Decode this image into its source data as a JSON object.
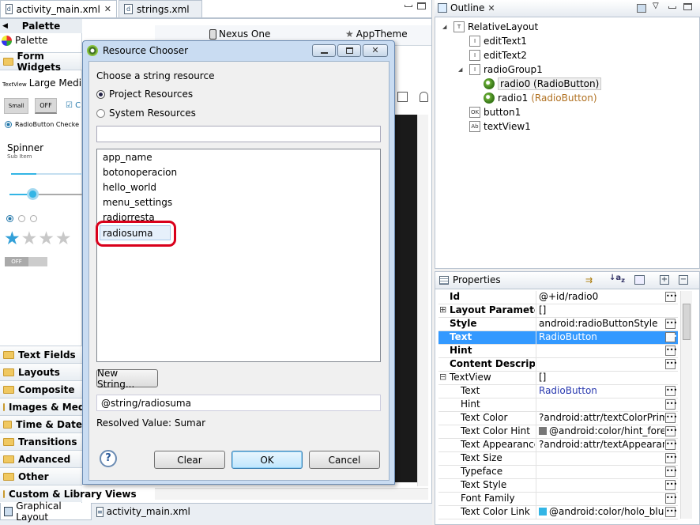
{
  "editor_tabs": [
    {
      "label": "activity_main.xml",
      "close": "✕"
    },
    {
      "label": "strings.xml"
    }
  ],
  "palette": {
    "header": "Palette",
    "title": "Palette",
    "section": "Form Widgets",
    "textview_label": "TextView",
    "text_sizes": "Large Mediu",
    "small_btn": "Small",
    "off_toggle": "OFF",
    "radio_checked": "RadioButton Checke",
    "spinner_title": "Spinner",
    "spinner_sub": "Sub Item",
    "switch_label": "OFF",
    "categories": [
      "Text Fields",
      "Layouts",
      "Composite",
      "Images & Med",
      "Time & Date",
      "Transitions",
      "Advanced",
      "Other",
      "Custom & Library Views"
    ]
  },
  "toolbar": {
    "device": "Nexus One",
    "theme": "AppTheme"
  },
  "bottom_tabs": {
    "graphical": "Graphical Layout",
    "xml": "activity_main.xml"
  },
  "outline": {
    "title": "Outline",
    "close": "✕",
    "items": [
      {
        "label": "RelativeLayout",
        "icon": "T"
      },
      {
        "label": "editText1",
        "icon": "I"
      },
      {
        "label": "editText2",
        "icon": "I"
      },
      {
        "label": "radioGroup1",
        "icon": "I"
      },
      {
        "label": "radio0 (RadioButton)",
        "icon": "radio"
      },
      {
        "label": "radio1",
        "suffix": "(RadioButton)",
        "icon": "radio"
      },
      {
        "label": "button1",
        "icon": "OK"
      },
      {
        "label": "textView1",
        "icon": "Ab"
      }
    ]
  },
  "properties": {
    "title": "Properties",
    "rows": [
      {
        "k": "Id",
        "v": "@+id/radio0",
        "style": "bold",
        "dots": true
      },
      {
        "k": "Layout Parameters",
        "v": "[]",
        "style": "bold",
        "expander": "⊞"
      },
      {
        "k": "Style",
        "v": "android:radioButtonStyle",
        "style": "bold",
        "dots": true
      },
      {
        "k": "Text",
        "v": "RadioButton",
        "style": "bold sel",
        "dots": true
      },
      {
        "k": "Hint",
        "v": "",
        "style": "bold",
        "dots": true
      },
      {
        "k": "Content Descript...",
        "v": "",
        "style": "bold",
        "dots": true
      },
      {
        "k": "TextView",
        "v": "[]",
        "style": "",
        "expander": "⊟"
      },
      {
        "k": "Text",
        "v": "RadioButton",
        "style": "indent",
        "dots": true,
        "blue": true
      },
      {
        "k": "Hint",
        "v": "",
        "style": "indent",
        "dots": true
      },
      {
        "k": "Text Color",
        "v": "?android:attr/textColorPrima...",
        "style": "indent",
        "dots": true
      },
      {
        "k": "Text Color Hint",
        "v": "@android:color/hint_fore...",
        "style": "indent",
        "dots": true,
        "swatch": "#777777"
      },
      {
        "k": "Text Appearance",
        "v": "?android:attr/textAppearance ...",
        "style": "indent",
        "dots": true
      },
      {
        "k": "Text Size",
        "v": "",
        "style": "indent",
        "dots": true
      },
      {
        "k": "Typeface",
        "v": "",
        "style": "indent",
        "dots": true
      },
      {
        "k": "Text Style",
        "v": "",
        "style": "indent",
        "dots": true
      },
      {
        "k": "Font Family",
        "v": "",
        "style": "indent",
        "dots": true
      },
      {
        "k": "Text Color Link",
        "v": "@android:color/holo_blue...",
        "style": "indent",
        "dots": true,
        "swatch": "#33b5e5"
      }
    ]
  },
  "dialog": {
    "title": "Resource Chooser",
    "prompt": "Choose a string resource",
    "radio_project": "Project Resources",
    "radio_system": "System Resources",
    "filter_value": "",
    "items": [
      "app_name",
      "botonoperacion",
      "hello_world",
      "menu_settings",
      "radiorresta",
      "radiosuma"
    ],
    "selected": "radiosuma",
    "new_string": "New String...",
    "resource_ref": "@string/radiosuma",
    "resolved": "Resolved Value: Sumar",
    "help": "?",
    "clear": "Clear",
    "ok": "OK",
    "cancel": "Cancel"
  },
  "colors": {
    "selection": "#3399ff",
    "highlight_ring": "#d9001b",
    "dialog_title": "#c9dcf2"
  }
}
